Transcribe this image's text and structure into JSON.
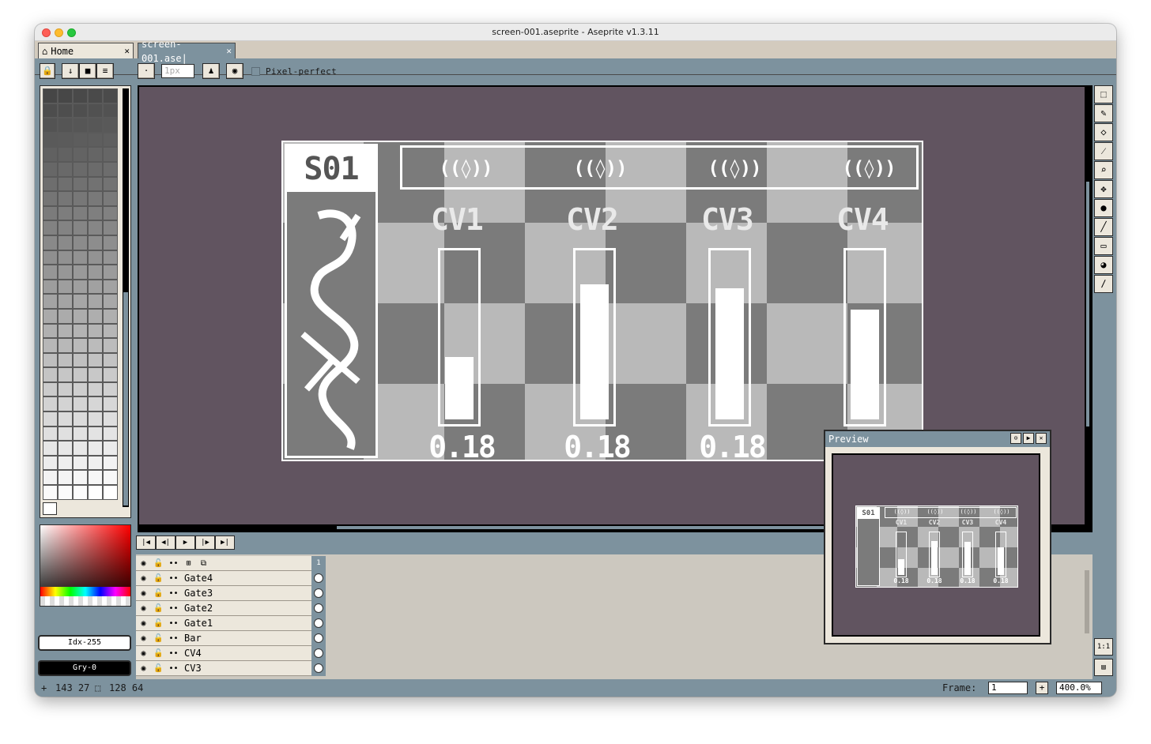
{
  "window": {
    "title": "screen-001.aseprite - Aseprite v1.3.11"
  },
  "tabs": [
    {
      "label": "Home",
      "icon": "home-icon"
    },
    {
      "label": "screen-001.ase|"
    }
  ],
  "toolbar": {
    "brush_size_placeholder": "1px",
    "pixel_perfect_label": "Pixel-perfect"
  },
  "color_bar": {
    "fg_label": "Idx-255",
    "bg_label": "Gry-0"
  },
  "sprite": {
    "header": "S01",
    "glyph": "((◊))",
    "channels": [
      {
        "label": "CV1",
        "value": "0.18",
        "level": 0.38
      },
      {
        "label": "CV2",
        "value": "0.18",
        "level": 0.82
      },
      {
        "label": "CV3",
        "value": "0.18",
        "level": 0.8
      },
      {
        "label": "CV4",
        "value": "0.18",
        "level": 0.67
      }
    ]
  },
  "preview": {
    "title": "Preview"
  },
  "timeline": {
    "frame_header": "1",
    "layers": [
      "Gate4",
      "Gate3",
      "Gate2",
      "Gate1",
      "Bar",
      "CV4",
      "CV3"
    ]
  },
  "status": {
    "cursor_pos": "143 27",
    "sprite_size": "128 64",
    "frame_label": "Frame:",
    "frame_value": "1",
    "zoom_value": "400.0%"
  },
  "colors": {
    "window_bg": "#7d929e",
    "canvas_bg": "#615460",
    "panel": "#ece7dc",
    "checker_dark": "#7b7b7b",
    "checker_light": "#b9b9b9"
  }
}
